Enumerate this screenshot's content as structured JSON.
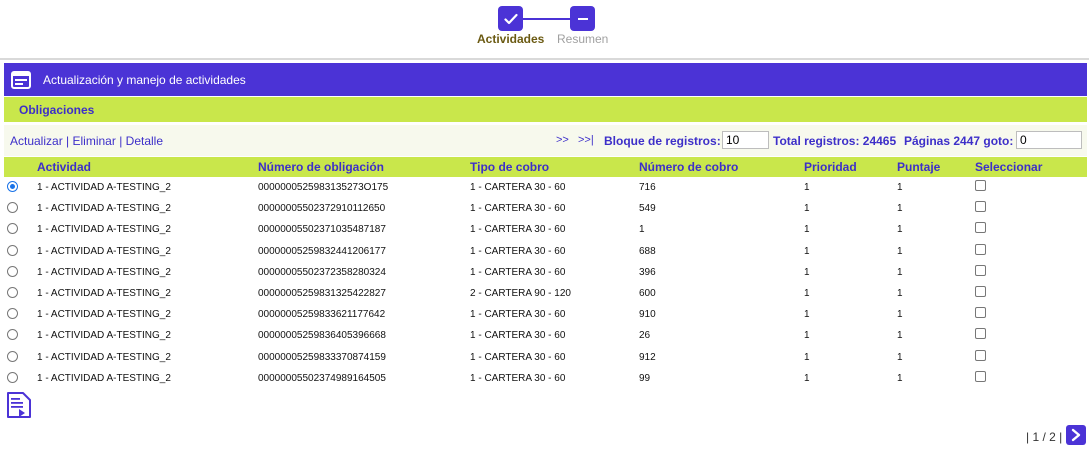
{
  "stepper": {
    "steps": [
      {
        "label": "Actividades",
        "icon": "check-icon",
        "state": "active"
      },
      {
        "label": "Resumen",
        "icon": "minus-icon",
        "state": "inactive"
      }
    ]
  },
  "header": {
    "title": "Actualización y manejo de actividades",
    "icon": "form-icon"
  },
  "section": {
    "title": "Obligaciones"
  },
  "toolbar": {
    "actualizar": "Actualizar",
    "eliminar": "Eliminar",
    "detalle": "Detalle",
    "separator": "|",
    "next": ">>",
    "last": ">>|",
    "block_label": "Bloque de registros:",
    "block_value": "10",
    "total_label": "Total registros: 24465",
    "pages_label": "Páginas 2447 goto:",
    "goto_value": "0"
  },
  "table": {
    "columns": [
      "Actividad",
      "Número de obligación",
      "Tipo de cobro",
      "Número de cobro",
      "Prioridad",
      "Puntaje",
      "Seleccionar"
    ],
    "rows": [
      {
        "selected": true,
        "actividad": "1 - ACTIVIDAD A-TESTING_2",
        "numero": "0000000525983135273O175",
        "tipo": "1 - CARTERA 30 - 60",
        "cobro": "716",
        "prioridad": "1",
        "puntaje": "1",
        "checked": false
      },
      {
        "selected": false,
        "actividad": "1 - ACTIVIDAD A-TESTING_2",
        "numero": "00000005502372910112650",
        "tipo": "1 - CARTERA 30 - 60",
        "cobro": "549",
        "prioridad": "1",
        "puntaje": "1",
        "checked": false
      },
      {
        "selected": false,
        "actividad": "1 - ACTIVIDAD A-TESTING_2",
        "numero": "00000005502371035487187",
        "tipo": "1 - CARTERA 30 - 60",
        "cobro": "1",
        "prioridad": "1",
        "puntaje": "1",
        "checked": false
      },
      {
        "selected": false,
        "actividad": "1 - ACTIVIDAD A-TESTING_2",
        "numero": "00000005259832441206177",
        "tipo": "1 - CARTERA 30 - 60",
        "cobro": "688",
        "prioridad": "1",
        "puntaje": "1",
        "checked": false
      },
      {
        "selected": false,
        "actividad": "1 - ACTIVIDAD A-TESTING_2",
        "numero": "00000005502372358280324",
        "tipo": "1 - CARTERA 30 - 60",
        "cobro": "396",
        "prioridad": "1",
        "puntaje": "1",
        "checked": false
      },
      {
        "selected": false,
        "actividad": "1 - ACTIVIDAD A-TESTING_2",
        "numero": "00000005259831325422827",
        "tipo": "2 - CARTERA 90 - 120",
        "cobro": "600",
        "prioridad": "1",
        "puntaje": "1",
        "checked": false
      },
      {
        "selected": false,
        "actividad": "1 - ACTIVIDAD A-TESTING_2",
        "numero": "00000005259833621177642",
        "tipo": "1 - CARTERA 30 - 60",
        "cobro": "910",
        "prioridad": "1",
        "puntaje": "1",
        "checked": false
      },
      {
        "selected": false,
        "actividad": "1 - ACTIVIDAD A-TESTING_2",
        "numero": "00000005259836405396668",
        "tipo": "1 - CARTERA 30 - 60",
        "cobro": "26",
        "prioridad": "1",
        "puntaje": "1",
        "checked": false
      },
      {
        "selected": false,
        "actividad": "1 - ACTIVIDAD A-TESTING_2",
        "numero": "00000005259833370874159",
        "tipo": "1 - CARTERA 30 - 60",
        "cobro": "912",
        "prioridad": "1",
        "puntaje": "1",
        "checked": false
      },
      {
        "selected": false,
        "actividad": "1 - ACTIVIDAD A-TESTING_2",
        "numero": "00000005502374989164505",
        "tipo": "1 - CARTERA 30 - 60",
        "cobro": "99",
        "prioridad": "1",
        "puntaje": "1",
        "checked": false
      }
    ]
  },
  "footer": {
    "doc_icon": "document-play-icon",
    "pager_text": "| 1 / 2 |",
    "next_icon": "chevron-right-icon"
  },
  "colors": {
    "primary": "#4b33d6",
    "accent_green": "#c9e74b",
    "link": "#3d2fc9",
    "toolbar_bg": "#f7f9ed"
  }
}
